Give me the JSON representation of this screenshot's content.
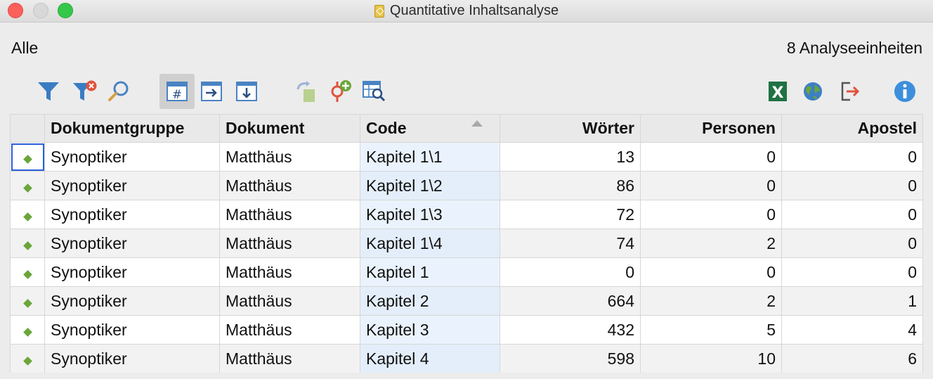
{
  "window": {
    "title": "Quantitative Inhaltsanalyse"
  },
  "header": {
    "scope": "Alle",
    "unit_count": "8 Analyseeinheiten"
  },
  "toolbar": {
    "items": [
      {
        "icon": "filter-icon"
      },
      {
        "icon": "filter-remove-icon"
      },
      {
        "icon": "search-icon"
      },
      {
        "icon": "count-table-icon",
        "active": true
      },
      {
        "icon": "export-right-icon"
      },
      {
        "icon": "export-down-icon"
      },
      {
        "icon": "redo-icon"
      },
      {
        "icon": "add-code-icon"
      },
      {
        "icon": "table-search-icon"
      },
      {
        "icon": "excel-icon"
      },
      {
        "icon": "globe-icon"
      },
      {
        "icon": "export-icon"
      },
      {
        "icon": "info-icon"
      }
    ]
  },
  "table": {
    "columns": [
      "",
      "Dokumentgruppe",
      "Dokument",
      "Code",
      "Wörter",
      "Personen",
      "Apostel"
    ],
    "rows": [
      [
        "Synoptiker",
        "Matthäus",
        "Kapitel 1\\1",
        "13",
        "0",
        "0"
      ],
      [
        "Synoptiker",
        "Matthäus",
        "Kapitel 1\\2",
        "86",
        "0",
        "0"
      ],
      [
        "Synoptiker",
        "Matthäus",
        "Kapitel 1\\3",
        "72",
        "0",
        "0"
      ],
      [
        "Synoptiker",
        "Matthäus",
        "Kapitel 1\\4",
        "74",
        "2",
        "0"
      ],
      [
        "Synoptiker",
        "Matthäus",
        "Kapitel 1",
        "0",
        "0",
        "0"
      ],
      [
        "Synoptiker",
        "Matthäus",
        "Kapitel 2",
        "664",
        "2",
        "1"
      ],
      [
        "Synoptiker",
        "Matthäus",
        "Kapitel 3",
        "432",
        "5",
        "4"
      ],
      [
        "Synoptiker",
        "Matthäus",
        "Kapitel 4",
        "598",
        "10",
        "6"
      ]
    ]
  },
  "colors": {
    "accent_green": "#6aa63a",
    "filter_blue": "#3a7cc4",
    "excel_green": "#1f7244",
    "info_blue": "#3d8fdc"
  }
}
